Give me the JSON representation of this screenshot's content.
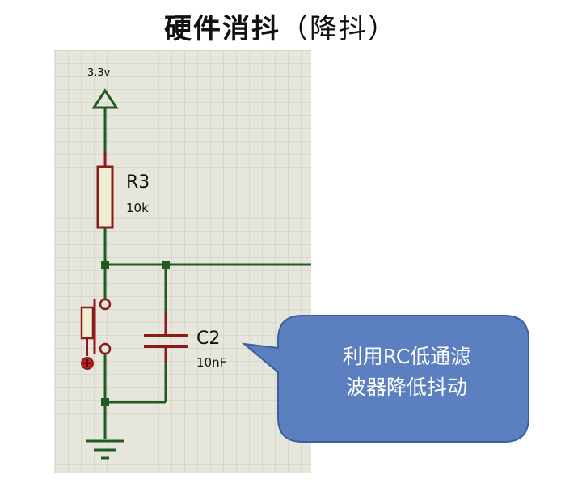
{
  "title": {
    "main": "硬件消抖",
    "paren": "（降抖）"
  },
  "supply": {
    "label": "3.3v"
  },
  "resistor": {
    "name": "R3",
    "value": "10k"
  },
  "capacitor": {
    "name": "C2",
    "value": "10nF"
  },
  "callout": {
    "line1": "利用RC低通滤",
    "line2": "波器降低抖动"
  },
  "colors": {
    "grid_bg": "#e6e6dc",
    "grid_line": "#c9c9bd",
    "wire": "#1f5d1f",
    "component": "#8b1a1a",
    "resistor_fill": "#f0eed2",
    "callout_fill": "#5b7fbf",
    "callout_stroke": "#3c5f9e"
  }
}
